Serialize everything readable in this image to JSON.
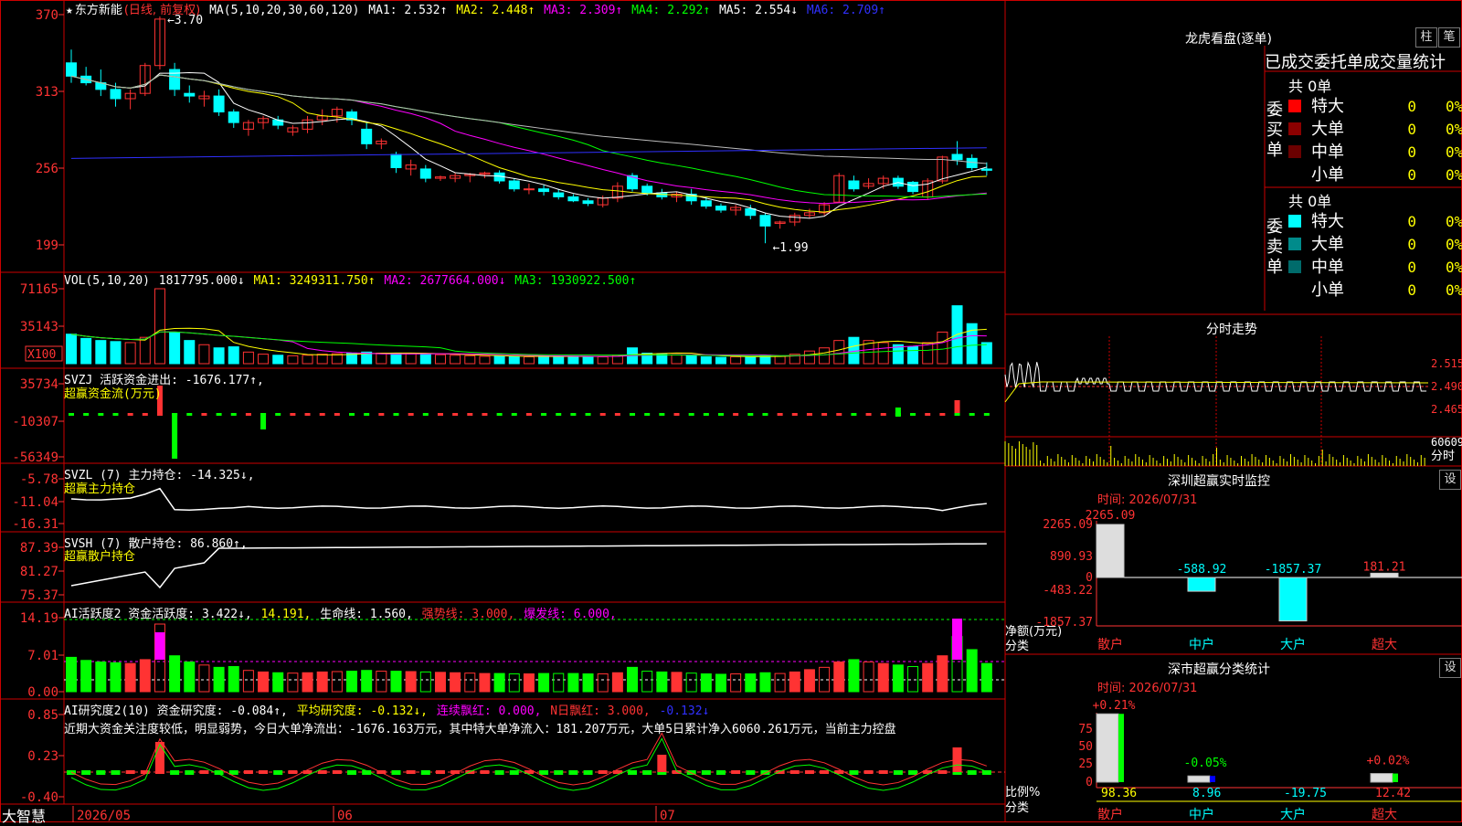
{
  "colors": {
    "up": "#ff3333",
    "down": "#00ffff",
    "ma1": "#ffffff",
    "ma2": "#ffff00",
    "ma3": "#ff00ff",
    "ma4": "#00ff00",
    "ma5": "#bbbbbb",
    "ma6": "#3030ff",
    "grid": "#8b0000",
    "border": "#cc0000"
  },
  "main": {
    "star": "★",
    "name": "东方新能",
    "period": "(日线, 前复权)",
    "ma_params": "MA(5,10,20,30,60,120)",
    "ma1": "MA1: 2.532↑",
    "ma2": "MA2: 2.448↑",
    "ma3": "MA3: 2.309↑",
    "ma4": "MA4: 2.292↑",
    "ma5": "MA5: 2.554↓",
    "ma6": "MA6: 2.709↑",
    "y_ticks": [
      "370",
      "313",
      "256",
      "199"
    ],
    "high_label": "3.70",
    "low_label": "1.99"
  },
  "vol": {
    "title": "VOL(5,10,20)",
    "value": "1817795.000↓",
    "ma1": "MA1: 3249311.750↑",
    "ma2": "MA2: 2677664.000↓",
    "ma3": "MA3: 1930922.500↑",
    "y_ticks": [
      "71165",
      "35143"
    ],
    "unit": "X100"
  },
  "svzj": {
    "title": "SVZJ  活跃资金进出: -1676.177↑,",
    "subtitle": "超赢资金流(万元)",
    "y_ticks": [
      "35734",
      "-10307",
      "-56349"
    ]
  },
  "svzl": {
    "title": "SVZL (7) 主力持仓: -14.325↓,",
    "subtitle": "超赢主力持仓",
    "y_ticks": [
      "-5.78",
      "-11.04",
      "-16.31"
    ]
  },
  "svsh": {
    "title": "SVSH (7) 散户持仓: 86.860↑,",
    "subtitle": "超赢散户持仓",
    "y_ticks": [
      "87.39",
      "81.27",
      "75.37"
    ]
  },
  "ai2": {
    "title": "AI活跃度2 资金活跃度: 3.422↓,",
    "v2": "14.191,",
    "v3": "生命线: 1.560,",
    "v4": "强势线: 3.000,",
    "v5": "爆发线: 6.000,",
    "y_ticks": [
      "14.19",
      "7.01",
      "0.00"
    ]
  },
  "ai_research": {
    "title": "AI研究度2(10) 资金研究度: -0.084↑,",
    "v2": "平均研究度: -0.132↓,",
    "v3": "连续飘红: 0.000,",
    "v4": "N日飘红: 3.000,",
    "v5": "-0.132↓",
    "comment": "近期大资金关注度较低，明显弱势，今日大单净流出：-1676.163万元，其中特大单净流入：181.207万元，大单5日累计净入6060.261万元，当前主力控盘",
    "y_ticks": [
      "0.85",
      "0.23",
      "-0.40"
    ]
  },
  "x_axis": {
    "brand": "大智慧",
    "labels": [
      "2026/05",
      "06",
      "07"
    ]
  },
  "dragon": {
    "title": "龙虎看盘(逐单)",
    "btn1": "柱",
    "btn2": "笔",
    "header": "已成交委托单成交量统计",
    "buy_label": "委买单",
    "sell_label": "委卖单",
    "buy_total": "共 0单",
    "sell_total": "共 0单",
    "buy_rows": [
      {
        "label": "特大",
        "count": "0",
        "pct": "0%",
        "color": "#ff0000"
      },
      {
        "label": "大单",
        "count": "0",
        "pct": "0%",
        "color": "#8b0000"
      },
      {
        "label": "中单",
        "count": "0",
        "pct": "0%",
        "color": "#6b0000"
      },
      {
        "label": "小单",
        "count": "0",
        "pct": "0%",
        "color": ""
      }
    ],
    "sell_rows": [
      {
        "label": "特大",
        "count": "0",
        "pct": "0%",
        "color": "#00ffff"
      },
      {
        "label": "大单",
        "count": "0",
        "pct": "0%",
        "color": "#008b8b"
      },
      {
        "label": "中单",
        "count": "0",
        "pct": "0%",
        "color": "#006b6b"
      },
      {
        "label": "小单",
        "count": "0",
        "pct": "0%",
        "color": ""
      }
    ]
  },
  "intraday": {
    "title": "分时走势",
    "price_ticks": [
      "2.515",
      "2.490",
      "2.465"
    ],
    "vol_tick": "60609",
    "unit": "分时"
  },
  "sz_monitor": {
    "title": "深圳超赢实时监控",
    "btn": "设",
    "time": "时间: 2026/07/31",
    "y_ticks": [
      "2265.09",
      "890.93",
      "0",
      "-483.22",
      "-1857.37"
    ],
    "y_label": "净额(万元)",
    "x_label": "分类",
    "bars": [
      {
        "cat": "散户",
        "value": 2265.09,
        "label": "2265.09"
      },
      {
        "cat": "中户",
        "value": -588.92,
        "label": "-588.92"
      },
      {
        "cat": "大户",
        "value": -1857.37,
        "label": "-1857.37"
      },
      {
        "cat": "超大",
        "value": 181.21,
        "label": "181.21"
      }
    ]
  },
  "sz_stats": {
    "title": "深市超赢分类统计",
    "btn": "设",
    "time": "时间: 2026/07/31",
    "y_ticks": [
      "75",
      "50",
      "25",
      "0"
    ],
    "y_label": "比例%",
    "x_label": "分类",
    "bars": [
      {
        "cat": "散户",
        "pct_change": "+0.21%",
        "value": 98.36,
        "label": "98.36"
      },
      {
        "cat": "中户",
        "pct_change": "-0.05%",
        "value": 8.96,
        "label": "8.96"
      },
      {
        "cat": "大户",
        "pct_change": "",
        "value": -19.75,
        "label": "-19.75"
      },
      {
        "cat": "超大",
        "pct_change": "+0.02%",
        "value": 12.42,
        "label": "12.42"
      }
    ]
  },
  "chart_data": {
    "type": "bar",
    "title": "",
    "series": [
      {
        "name": "daily",
        "values": [
          [
            3.35,
            3.45,
            3.2,
            3.25
          ],
          [
            3.25,
            3.32,
            3.18,
            3.2
          ],
          [
            3.2,
            3.3,
            3.1,
            3.15
          ],
          [
            3.15,
            3.2,
            3.02,
            3.08
          ],
          [
            3.08,
            3.15,
            3.0,
            3.12
          ],
          [
            3.12,
            3.35,
            3.1,
            3.33
          ],
          [
            3.33,
            3.7,
            3.3,
            3.68
          ],
          [
            3.3,
            3.35,
            3.1,
            3.15
          ],
          [
            3.12,
            3.18,
            3.05,
            3.1
          ],
          [
            3.08,
            3.14,
            3.02,
            3.1
          ],
          [
            3.1,
            3.15,
            2.95,
            2.98
          ],
          [
            2.98,
            3.0,
            2.86,
            2.9
          ],
          [
            2.85,
            2.92,
            2.8,
            2.9
          ],
          [
            2.9,
            2.95,
            2.85,
            2.93
          ],
          [
            2.92,
            2.95,
            2.85,
            2.88
          ],
          [
            2.83,
            2.88,
            2.8,
            2.86
          ],
          [
            2.85,
            2.95,
            2.82,
            2.92
          ],
          [
            2.92,
            3.0,
            2.88,
            2.95
          ],
          [
            2.95,
            3.02,
            2.9,
            3.0
          ],
          [
            2.98,
            3.0,
            2.88,
            2.92
          ],
          [
            2.85,
            2.9,
            2.7,
            2.74
          ],
          [
            2.74,
            2.78,
            2.7,
            2.76
          ],
          [
            2.66,
            2.68,
            2.52,
            2.56
          ],
          [
            2.55,
            2.62,
            2.5,
            2.58
          ],
          [
            2.55,
            2.58,
            2.45,
            2.48
          ],
          [
            2.48,
            2.5,
            2.46,
            2.49
          ],
          [
            2.48,
            2.52,
            2.45,
            2.5
          ],
          [
            2.5,
            2.52,
            2.45,
            2.51
          ],
          [
            2.51,
            2.53,
            2.48,
            2.52
          ],
          [
            2.52,
            2.54,
            2.44,
            2.46
          ],
          [
            2.46,
            2.48,
            2.38,
            2.4
          ],
          [
            2.4,
            2.44,
            2.36,
            2.4
          ],
          [
            2.4,
            2.43,
            2.35,
            2.38
          ],
          [
            2.37,
            2.4,
            2.32,
            2.34
          ],
          [
            2.34,
            2.36,
            2.3,
            2.31
          ],
          [
            2.31,
            2.33,
            2.27,
            2.29
          ],
          [
            2.28,
            2.35,
            2.26,
            2.33
          ],
          [
            2.33,
            2.45,
            2.3,
            2.42
          ],
          [
            2.5,
            2.52,
            2.38,
            2.4
          ],
          [
            2.42,
            2.44,
            2.35,
            2.37
          ],
          [
            2.37,
            2.4,
            2.32,
            2.34
          ],
          [
            2.34,
            2.38,
            2.3,
            2.36
          ],
          [
            2.36,
            2.4,
            2.28,
            2.31
          ],
          [
            2.31,
            2.34,
            2.25,
            2.27
          ],
          [
            2.27,
            2.29,
            2.22,
            2.24
          ],
          [
            2.24,
            2.28,
            2.2,
            2.26
          ],
          [
            2.25,
            2.28,
            2.17,
            2.2
          ],
          [
            2.2,
            2.22,
            1.99,
            2.12
          ],
          [
            2.14,
            2.16,
            2.1,
            2.15
          ],
          [
            2.15,
            2.22,
            2.12,
            2.2
          ],
          [
            2.2,
            2.25,
            2.18,
            2.22
          ],
          [
            2.22,
            2.3,
            2.2,
            2.28
          ],
          [
            2.3,
            2.52,
            2.3,
            2.5
          ],
          [
            2.46,
            2.5,
            2.38,
            2.4
          ],
          [
            2.42,
            2.48,
            2.4,
            2.44
          ],
          [
            2.44,
            2.5,
            2.4,
            2.48
          ],
          [
            2.48,
            2.5,
            2.4,
            2.42
          ],
          [
            2.45,
            2.46,
            2.36,
            2.38
          ],
          [
            2.34,
            2.48,
            2.32,
            2.46
          ],
          [
            2.46,
            2.65,
            2.44,
            2.64
          ],
          [
            2.66,
            2.76,
            2.58,
            2.62
          ],
          [
            2.63,
            2.66,
            2.54,
            2.56
          ],
          [
            2.55,
            2.6,
            2.5,
            2.54
          ]
        ]
      },
      {
        "name": "VOL",
        "values": [
          28000,
          24000,
          22000,
          21000,
          20000,
          25000,
          71165,
          30000,
          22000,
          18000,
          15000,
          16000,
          11000,
          9000,
          8000,
          7500,
          8000,
          9000,
          9500,
          10000,
          11000,
          10000,
          10000,
          9500,
          9000,
          8500,
          8000,
          7500,
          7000,
          7000,
          6500,
          6500,
          7000,
          7000,
          7000,
          6500,
          6500,
          8000,
          15000,
          10000,
          9000,
          8500,
          7500,
          6500,
          6000,
          6500,
          6500,
          8000,
          7000,
          9000,
          12000,
          15000,
          22000,
          25000,
          22000,
          20000,
          18000,
          16000,
          20000,
          30000,
          55000,
          38000,
          20000
        ]
      }
    ]
  }
}
